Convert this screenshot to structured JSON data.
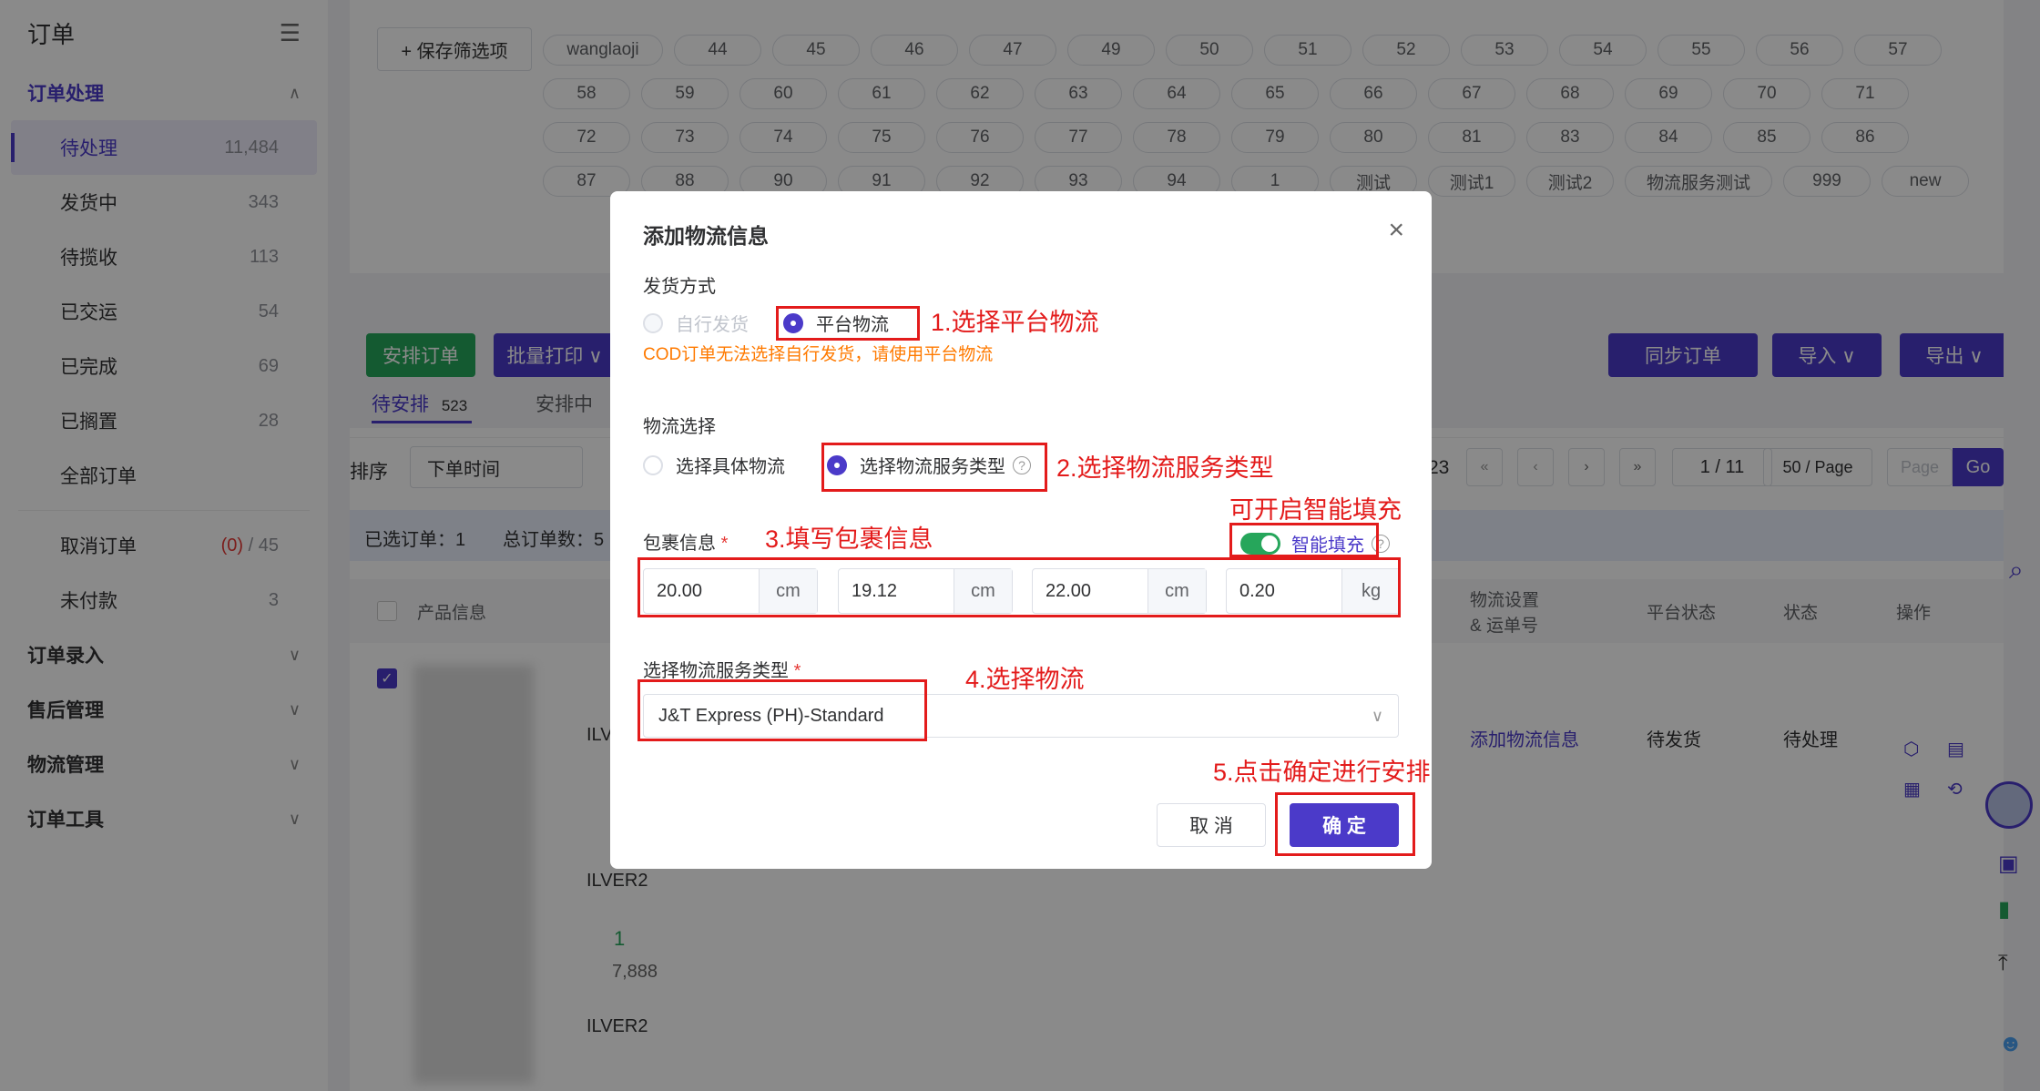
{
  "sidebar": {
    "title": "订单",
    "groups": [
      {
        "label": "订单处理"
      },
      {
        "label": "订单录入"
      },
      {
        "label": "售后管理"
      },
      {
        "label": "物流管理"
      },
      {
        "label": "订单工具"
      }
    ],
    "items": [
      {
        "label": "待处理",
        "count": "11,484"
      },
      {
        "label": "发货中",
        "count": "343"
      },
      {
        "label": "待揽收",
        "count": "113"
      },
      {
        "label": "已交运",
        "count": "54"
      },
      {
        "label": "已完成",
        "count": "69"
      },
      {
        "label": "已搁置",
        "count": "28"
      },
      {
        "label": "全部订单",
        "count": ""
      },
      {
        "label": "取消订单",
        "count_red": "(0)",
        "count": "/ 45"
      },
      {
        "label": "未付款",
        "count": "3"
      }
    ]
  },
  "filters": {
    "save_label": "+ 保存筛选项",
    "tags": [
      "wanglaoji",
      "44",
      "45",
      "46",
      "47",
      "49",
      "50",
      "51",
      "52",
      "53",
      "54",
      "55",
      "56",
      "57",
      "58",
      "59",
      "60",
      "61",
      "62",
      "63",
      "64",
      "65",
      "66",
      "67",
      "68",
      "69",
      "70",
      "71",
      "72",
      "73",
      "74",
      "75",
      "76",
      "77",
      "78",
      "79",
      "80",
      "81",
      "83",
      "84",
      "85",
      "86",
      "87",
      "88",
      "90",
      "91",
      "92",
      "93",
      "94",
      "1",
      "测试",
      "测试1",
      "测试2",
      "物流服务测试",
      "999",
      "new"
    ]
  },
  "toolbar": {
    "arrange": "安排订单",
    "batch_print": "批量打印 ∨",
    "sync": "同步订单",
    "import": "导入 ∨",
    "export": "导出 ∨"
  },
  "tabs": {
    "pending_arrange": "待安排",
    "pending_count": "523",
    "arranging": "安排中"
  },
  "list": {
    "sort_label": "排序",
    "sort_value": "下单时间",
    "selected": "已选订单：1",
    "total": "总订单数：5",
    "pager": "1 / 11",
    "per_page": "50 / Page",
    "page_placeholder": "Page",
    "go": "Go",
    "col_product": "产品信息",
    "col_logistics": "物流设置\n& 运单号",
    "col_platform_status": "平台状态",
    "col_status": "状态",
    "col_actions": "操作",
    "row_add_logistics": "添加物流信息",
    "row_platform_status": "待发货",
    "row_status": "待处理",
    "row_sku1": "ILV",
    "row_sku2": "ILVER2",
    "row_sku3": "ILVER2",
    "row_qty": "1",
    "row_price": "7,888",
    "page_num_partial": "23"
  },
  "modal": {
    "title": "添加物流信息",
    "ship_method_label": "发货方式",
    "self_ship": "自行发货",
    "platform_ship": "平台物流",
    "warning": "COD订单无法选择自行发货，请使用平台物流",
    "logistics_select_label": "物流选择",
    "specific_logistics": "选择具体物流",
    "service_type": "选择物流服务类型",
    "package_label": "包裹信息",
    "smart_fill": "智能填充",
    "dims": [
      {
        "value": "20.00",
        "unit": "cm"
      },
      {
        "value": "19.12",
        "unit": "cm"
      },
      {
        "value": "22.00",
        "unit": "cm"
      },
      {
        "value": "0.20",
        "unit": "kg"
      }
    ],
    "service_type_label": "选择物流服务类型",
    "service_value": "J&T Express (PH)-Standard",
    "cancel": "取 消",
    "confirm": "确 定"
  },
  "annotations": {
    "a1": "1.选择平台物流",
    "a2": "2.选择物流服务类型",
    "a_smart": "可开启智能填充",
    "a3": "3.填写包裹信息",
    "a4": "4.选择物流",
    "a5": "5.点击确定进行安排"
  },
  "colors": {
    "primary": "#4b3ac9",
    "green": "#26a65b",
    "annotation": "#e31b1b",
    "warning": "#ff7a00"
  }
}
